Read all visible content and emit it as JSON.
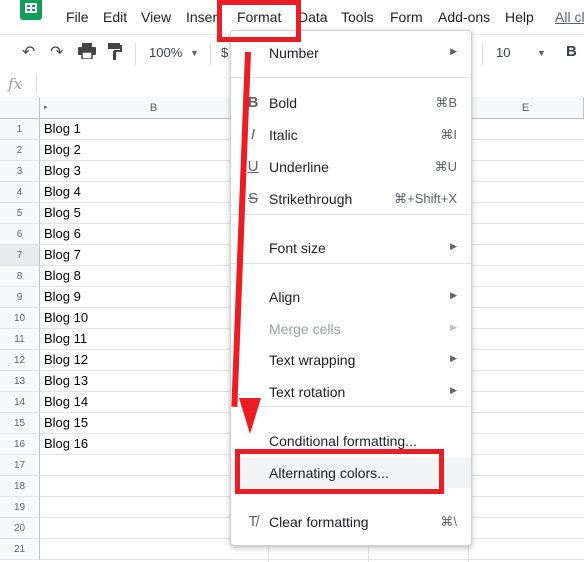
{
  "app": {
    "logo_icon": "google-sheets-logo-icon"
  },
  "menubar": {
    "items": [
      "File",
      "Edit",
      "View",
      "Inser",
      "Format",
      "Data",
      "Tools",
      "Form",
      "Add-ons",
      "Help"
    ],
    "link_text": "All cl"
  },
  "toolbar": {
    "undo_icon": "undo-icon",
    "redo_icon": "redo-icon",
    "print_icon": "print-icon",
    "paint_format_icon": "paint-format-icon",
    "zoom": "100%",
    "currency_partial": "$",
    "font_size": "10",
    "bold_label": "B"
  },
  "formula_bar": {
    "fx_label": "fx"
  },
  "grid": {
    "column_headers": [
      "",
      "B",
      "",
      "E"
    ],
    "row_numbers": [
      "1",
      "2",
      "3",
      "4",
      "5",
      "6",
      "7",
      "8",
      "9",
      "10",
      "11",
      "12",
      "13",
      "14",
      "15",
      "16",
      "17",
      "18",
      "19",
      "20",
      "21"
    ],
    "column_b_values": [
      "Blog 1",
      "Blog 2",
      "Blog 3",
      "Blog 4",
      "Blog 5",
      "Blog 6",
      "Blog 7",
      "Blog 8",
      "Blog 9",
      "Blog 10",
      "Blog 11",
      "Blog 12",
      "Blog 13",
      "Blog 14",
      "Blog 15",
      "Blog 16"
    ],
    "selected_row": "7"
  },
  "format_menu": {
    "items": [
      {
        "label": "Number",
        "submenu": true
      },
      {
        "label": "Bold",
        "icon": "bold-icon",
        "icon_glyph": "B",
        "shortcut": "⌘B"
      },
      {
        "label": "Italic",
        "icon": "italic-icon",
        "icon_glyph": "I",
        "shortcut": "⌘I"
      },
      {
        "label": "Underline",
        "icon": "underline-icon",
        "icon_glyph": "U",
        "shortcut": "⌘U"
      },
      {
        "label": "Strikethrough",
        "icon": "strikethrough-icon",
        "icon_glyph": "S",
        "shortcut": "⌘+Shift+X"
      },
      {
        "label": "Font size",
        "submenu": true
      },
      {
        "label": "Align",
        "submenu": true
      },
      {
        "label": "Merge cells",
        "submenu": true,
        "disabled": true
      },
      {
        "label": "Text wrapping",
        "submenu": true
      },
      {
        "label": "Text rotation",
        "submenu": true
      },
      {
        "label": "Conditional formatting..."
      },
      {
        "label": "Alternating colors...",
        "highlighted": true
      },
      {
        "label": "Clear formatting",
        "icon": "clear-formatting-icon",
        "icon_glyph": "T̸",
        "shortcut": "⌘\\"
      }
    ]
  },
  "annotation": {
    "color": "#ec1c24"
  }
}
